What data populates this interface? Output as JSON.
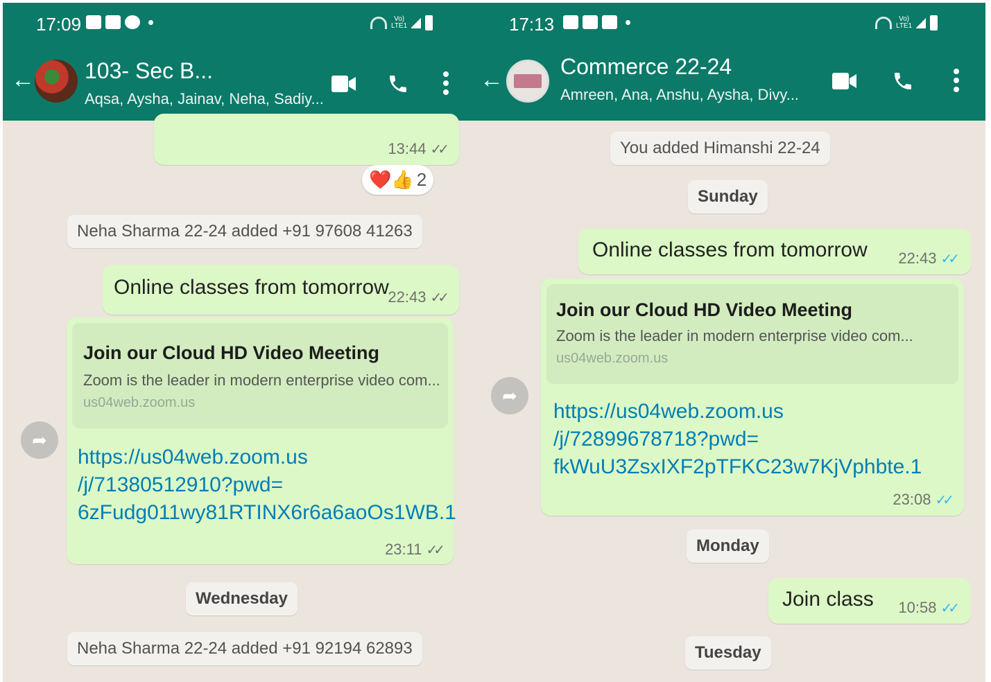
{
  "left": {
    "status": {
      "time": "17:09",
      "icons": [
        "facebook-icon",
        "youtube-icon",
        "messenger-icon"
      ]
    },
    "header": {
      "title": "103- Sec B...",
      "subtitle": "Aqsa, Aysha, Jainav, Neha, Sadiy..."
    },
    "prev_msg_time": "13:44",
    "reactions": {
      "emojis": "❤️👍",
      "count": "2"
    },
    "sys1": "Neha Sharma 22-24 added +91 97608 41263",
    "msg1": {
      "text": "Online classes from tomorrow",
      "time": "22:43"
    },
    "link_msg": {
      "preview_title": "Join our Cloud HD Video Meeting",
      "preview_desc": "Zoom is the leader in modern enterprise video com...",
      "preview_host": "us04web.zoom.us",
      "line1": "https://us04web.zoom.us",
      "line2": "/j/71380512910?pwd=",
      "line3": "6zFudg011wy81RTINX6r6a6aoOs1WB.1",
      "time": "23:11"
    },
    "day1": "Wednesday",
    "sys2": "Neha Sharma 22-24 added +91 92194 62893"
  },
  "right": {
    "status": {
      "time": "17:13",
      "icons": [
        "gallery-icon",
        "facebook-icon",
        "youtube-icon"
      ]
    },
    "header": {
      "title": "Commerce 22-24",
      "subtitle": "Amreen, Ana, Anshu, Aysha, Divy..."
    },
    "sys1": "You added Himanshi 22-24",
    "day1": "Sunday",
    "msg1": {
      "text": "Online classes from tomorrow",
      "time": "22:43"
    },
    "link_msg": {
      "preview_title": "Join our Cloud HD Video Meeting",
      "preview_desc": "Zoom is the leader in modern enterprise video com...",
      "preview_host": "us04web.zoom.us",
      "line1": "https://us04web.zoom.us",
      "line2": "/j/72899678718?pwd=",
      "line3": "fkWuU3ZsxIXF2pTFKC23w7KjVphbte.1",
      "time": "23:08"
    },
    "day2": "Monday",
    "msg2": {
      "text": "Join class",
      "time": "10:58"
    },
    "day3": "Tuesday"
  },
  "ticks": "✓✓",
  "colors": {
    "header": "#0b7a68",
    "outgoing": "#dcf8c6",
    "chat_bg": "#ece5dd",
    "link": "#027eb5",
    "read_ticks": "#34b7f1"
  }
}
